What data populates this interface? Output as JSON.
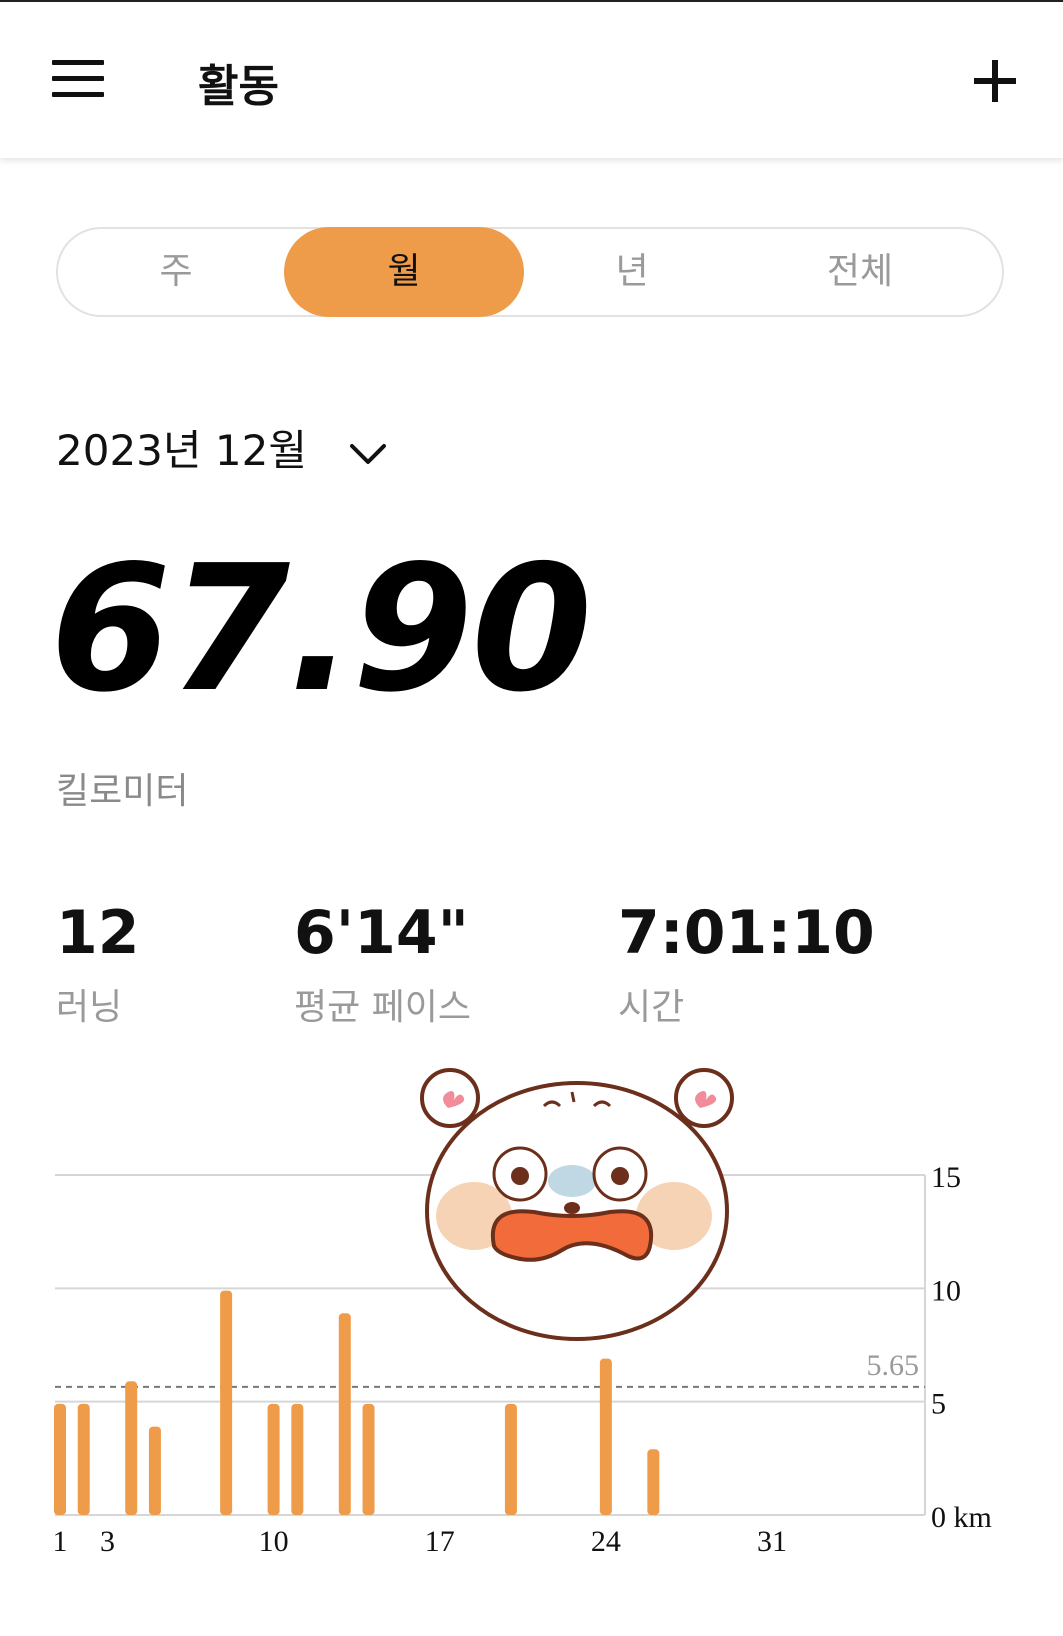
{
  "app": {
    "title": "활동"
  },
  "tabs": [
    {
      "label": "주",
      "active": false
    },
    {
      "label": "월",
      "active": true
    },
    {
      "label": "년",
      "active": false
    },
    {
      "label": "전체",
      "active": false
    }
  ],
  "period": {
    "label": "2023년 12월"
  },
  "summary": {
    "total_distance": "67.90",
    "unit_label": "킬로미터"
  },
  "stats": [
    {
      "value": "12",
      "label": "러닝"
    },
    {
      "value": "6'14\"",
      "label": "평균 페이스"
    },
    {
      "value": "7:01:10",
      "label": "시간"
    }
  ],
  "colors": {
    "accent": "#EF9C4A",
    "text": "#111111",
    "muted": "#9a9a9a"
  },
  "icons": {
    "menu": "menu-icon",
    "add": "plus-icon",
    "dropdown": "chevron-down-icon"
  },
  "chart_data": {
    "type": "bar",
    "x_ticks": [
      "1",
      "3",
      "10",
      "17",
      "24",
      "31"
    ],
    "x_tick_values": [
      1,
      3,
      10,
      17,
      24,
      31
    ],
    "y_ticks": [
      "0 km",
      "5",
      "10",
      "15"
    ],
    "y_tick_values": [
      0,
      5,
      10,
      15
    ],
    "ylim": [
      0,
      15
    ],
    "xlim": [
      1,
      31
    ],
    "average": {
      "value": 5.65,
      "label": "5.65"
    },
    "bars": [
      {
        "day": 1,
        "value": 4.9
      },
      {
        "day": 2,
        "value": 4.9
      },
      {
        "day": 4,
        "value": 5.9
      },
      {
        "day": 5,
        "value": 3.9
      },
      {
        "day": 8,
        "value": 9.9
      },
      {
        "day": 10,
        "value": 4.9
      },
      {
        "day": 11,
        "value": 4.9
      },
      {
        "day": 13,
        "value": 8.9
      },
      {
        "day": 14,
        "value": 4.9
      },
      {
        "day": 20,
        "value": 4.9
      },
      {
        "day": 24,
        "value": 6.9
      },
      {
        "day": 26,
        "value": 2.9
      }
    ]
  }
}
